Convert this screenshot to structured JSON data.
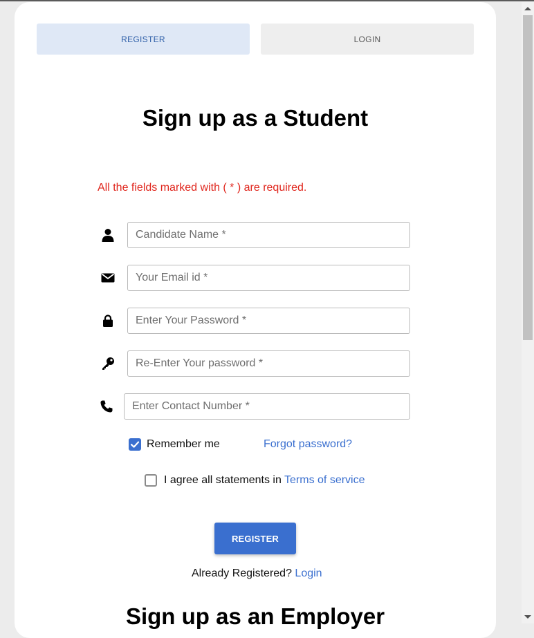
{
  "tabs": {
    "register": "REGISTER",
    "login": "LOGIN"
  },
  "student": {
    "title": "Sign up as a Student",
    "required_note": "All the fields marked with ( * ) are required.",
    "fields": {
      "name_placeholder": "Candidate Name *",
      "email_placeholder": "Your Email id *",
      "password_placeholder": "Enter Your Password *",
      "repassword_placeholder": "Re-Enter Your password *",
      "contact_placeholder": "Enter Contact Number *"
    },
    "remember_me": "Remember me",
    "remember_checked": true,
    "forgot_password": "Forgot password?",
    "agree_text": "I agree all statements in",
    "terms_link": "Terms of service",
    "agree_checked": false,
    "register_button": "REGISTER",
    "already_registered": "Already Registered?",
    "login_link": "Login"
  },
  "employer": {
    "title": "Sign up as an Employer"
  },
  "icons": {
    "name": "user-icon",
    "email": "envelope-icon",
    "password": "lock-icon",
    "repassword": "key-icon",
    "contact": "phone-icon"
  },
  "colors": {
    "accent": "#3a6fcf",
    "error": "#e0261d",
    "tab_active_bg": "#dfe8f6"
  }
}
